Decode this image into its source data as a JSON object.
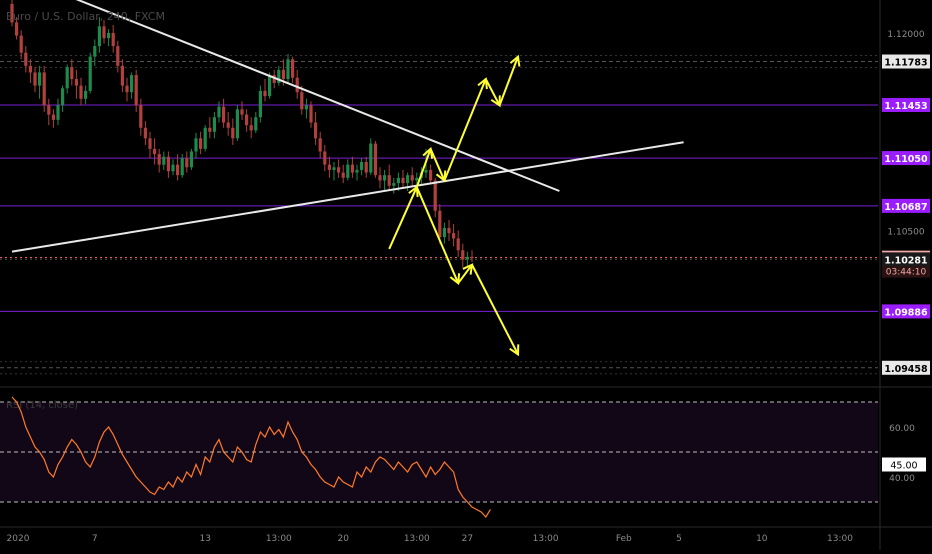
{
  "symbol_title": "Euro / U.S. Dollar, 240, FXCM",
  "colors": {
    "background": "#000000",
    "up_candle": "#1f8a4c",
    "down_candle": "#b2413d",
    "trendline": "#e9e9e9",
    "projection": "#ffff33",
    "level_line": "#7a1fd6",
    "level_badge": "#9b1cff",
    "rsi_line": "#ff7a2a",
    "rsi_fill": "#120716",
    "axis_text": "#8a8a8a"
  },
  "chart_data": [
    {
      "type": "candlestick",
      "title": "Euro / U.S. Dollar, 240, FXCM",
      "x_ticks": [
        "2020",
        "7",
        "13",
        "13:00",
        "20",
        "13:00",
        "27",
        "13:00",
        "Feb",
        "5",
        "10",
        "13:00"
      ],
      "y_ticks": [
        "1.12000",
        "1.10500"
      ],
      "ylim": [
        1.0935,
        1.1225
      ],
      "grid": false,
      "levels": [
        {
          "price": 1.11783,
          "label": "1.11783",
          "style": "gray"
        },
        {
          "price": 1.11453,
          "label": "1.11453",
          "style": "purple"
        },
        {
          "price": 1.1105,
          "label": "1.11050",
          "style": "purple"
        },
        {
          "price": 1.10687,
          "label": "1.10687",
          "style": "purple"
        },
        {
          "price": 1.10294,
          "label": "1.10294",
          "style": "current"
        },
        {
          "price": 1.10281,
          "label": "1.10281",
          "style": "dark"
        },
        {
          "price": 1.09886,
          "label": "1.09886",
          "style": "purple"
        },
        {
          "price": 1.09458,
          "label": "1.09458",
          "style": "gray"
        }
      ],
      "countdown": "03:44:10",
      "ohlc": [
        [
          1.1222,
          1.1225,
          1.1205,
          1.1208
        ],
        [
          1.1208,
          1.1212,
          1.1195,
          1.1198
        ],
        [
          1.1198,
          1.1202,
          1.118,
          1.1185
        ],
        [
          1.1185,
          1.119,
          1.117,
          1.1175
        ],
        [
          1.1175,
          1.118,
          1.1162,
          1.117
        ],
        [
          1.117,
          1.1174,
          1.1155,
          1.116
        ],
        [
          1.116,
          1.1175,
          1.115,
          1.117
        ],
        [
          1.117,
          1.1175,
          1.114,
          1.1145
        ],
        [
          1.1145,
          1.115,
          1.113,
          1.1138
        ],
        [
          1.1138,
          1.1142,
          1.1128,
          1.1134
        ],
        [
          1.1134,
          1.115,
          1.113,
          1.1145
        ],
        [
          1.1145,
          1.116,
          1.114,
          1.1158
        ],
        [
          1.1158,
          1.1176,
          1.1154,
          1.1174
        ],
        [
          1.1174,
          1.118,
          1.116,
          1.1165
        ],
        [
          1.1165,
          1.1172,
          1.115,
          1.116
        ],
        [
          1.116,
          1.1166,
          1.1145,
          1.115
        ],
        [
          1.115,
          1.116,
          1.1146,
          1.1156
        ],
        [
          1.1156,
          1.1185,
          1.1154,
          1.1182
        ],
        [
          1.1182,
          1.1195,
          1.1175,
          1.119
        ],
        [
          1.119,
          1.1212,
          1.1185,
          1.1205
        ],
        [
          1.1205,
          1.121,
          1.1192,
          1.1196
        ],
        [
          1.1196,
          1.1203,
          1.119,
          1.12
        ],
        [
          1.12,
          1.1206,
          1.1185,
          1.119
        ],
        [
          1.119,
          1.1194,
          1.117,
          1.1175
        ],
        [
          1.1175,
          1.118,
          1.1155,
          1.116
        ],
        [
          1.116,
          1.1166,
          1.1148,
          1.1155
        ],
        [
          1.1155,
          1.117,
          1.115,
          1.1168
        ],
        [
          1.1168,
          1.1172,
          1.114,
          1.1145
        ],
        [
          1.1145,
          1.115,
          1.1122,
          1.1128
        ],
        [
          1.1128,
          1.1133,
          1.1115,
          1.112
        ],
        [
          1.112,
          1.1125,
          1.1105,
          1.1112
        ],
        [
          1.1112,
          1.112,
          1.11,
          1.1108
        ],
        [
          1.1108,
          1.1112,
          1.1094,
          1.11
        ],
        [
          1.11,
          1.111,
          1.1096,
          1.1106
        ],
        [
          1.1106,
          1.111,
          1.109,
          1.1095
        ],
        [
          1.1095,
          1.1104,
          1.1092,
          1.11
        ],
        [
          1.11,
          1.1108,
          1.1088,
          1.1092
        ],
        [
          1.1092,
          1.1108,
          1.109,
          1.1105
        ],
        [
          1.1105,
          1.111,
          1.1094,
          1.1098
        ],
        [
          1.1098,
          1.1112,
          1.1096,
          1.111
        ],
        [
          1.111,
          1.1124,
          1.1105,
          1.112
        ],
        [
          1.112,
          1.1125,
          1.1108,
          1.1112
        ],
        [
          1.1112,
          1.113,
          1.111,
          1.1128
        ],
        [
          1.1128,
          1.1136,
          1.112,
          1.1125
        ],
        [
          1.1125,
          1.114,
          1.112,
          1.1136
        ],
        [
          1.1136,
          1.1148,
          1.1132,
          1.1144
        ],
        [
          1.1144,
          1.115,
          1.1128,
          1.1132
        ],
        [
          1.1132,
          1.114,
          1.1122,
          1.1128
        ],
        [
          1.1128,
          1.1135,
          1.1115,
          1.112
        ],
        [
          1.112,
          1.1145,
          1.1118,
          1.1142
        ],
        [
          1.1142,
          1.1148,
          1.1134,
          1.1138
        ],
        [
          1.1138,
          1.1142,
          1.1125,
          1.113
        ],
        [
          1.113,
          1.1136,
          1.112,
          1.1126
        ],
        [
          1.1126,
          1.114,
          1.1124,
          1.1136
        ],
        [
          1.1136,
          1.116,
          1.1132,
          1.1156
        ],
        [
          1.1156,
          1.1165,
          1.1148,
          1.1152
        ],
        [
          1.1152,
          1.117,
          1.115,
          1.1168
        ],
        [
          1.1168,
          1.1172,
          1.1158,
          1.1162
        ],
        [
          1.1162,
          1.1175,
          1.116,
          1.1172
        ],
        [
          1.1172,
          1.118,
          1.116,
          1.1165
        ],
        [
          1.1165,
          1.1184,
          1.1162,
          1.118
        ],
        [
          1.118,
          1.1182,
          1.1162,
          1.1166
        ],
        [
          1.1166,
          1.1172,
          1.115,
          1.1155
        ],
        [
          1.1155,
          1.116,
          1.1138,
          1.1142
        ],
        [
          1.1142,
          1.115,
          1.1135,
          1.1145
        ],
        [
          1.1145,
          1.1148,
          1.1128,
          1.1132
        ],
        [
          1.1132,
          1.114,
          1.1115,
          1.112
        ],
        [
          1.112,
          1.1125,
          1.1105,
          1.111
        ],
        [
          1.111,
          1.1115,
          1.1095,
          1.11
        ],
        [
          1.11,
          1.1106,
          1.109,
          1.1096
        ],
        [
          1.1096,
          1.1102,
          1.1088,
          1.1098
        ],
        [
          1.1098,
          1.1104,
          1.109,
          1.1094
        ],
        [
          1.1094,
          1.11,
          1.1086,
          1.109
        ],
        [
          1.109,
          1.1104,
          1.1088,
          1.11
        ],
        [
          1.11,
          1.1106,
          1.109,
          1.1094
        ],
        [
          1.1094,
          1.11,
          1.1088,
          1.1096
        ],
        [
          1.1096,
          1.1105,
          1.1092,
          1.1102
        ],
        [
          1.1102,
          1.1106,
          1.109,
          1.1094
        ],
        [
          1.1094,
          1.112,
          1.1092,
          1.1116
        ],
        [
          1.1116,
          1.1118,
          1.109,
          1.1092
        ],
        [
          1.1092,
          1.1098,
          1.1082,
          1.1088
        ],
        [
          1.1088,
          1.1096,
          1.108,
          1.1092
        ],
        [
          1.1092,
          1.11,
          1.108,
          1.1084
        ],
        [
          1.1084,
          1.109,
          1.1078,
          1.1086
        ],
        [
          1.1086,
          1.1094,
          1.108,
          1.109
        ],
        [
          1.109,
          1.1096,
          1.1082,
          1.1086
        ],
        [
          1.1086,
          1.1094,
          1.108,
          1.1092
        ],
        [
          1.1092,
          1.1098,
          1.1084,
          1.1088
        ],
        [
          1.1088,
          1.1094,
          1.1082,
          1.109
        ],
        [
          1.109,
          1.1098,
          1.1085,
          1.1094
        ],
        [
          1.1094,
          1.1112,
          1.109,
          1.1096
        ],
        [
          1.1096,
          1.11,
          1.1085,
          1.1088
        ],
        [
          1.1088,
          1.109,
          1.106,
          1.1065
        ],
        [
          1.1065,
          1.107,
          1.104,
          1.1045
        ],
        [
          1.1045,
          1.1056,
          1.104,
          1.1052
        ],
        [
          1.1052,
          1.1058,
          1.1042,
          1.1048
        ],
        [
          1.1048,
          1.1055,
          1.1038,
          1.1044
        ],
        [
          1.1044,
          1.105,
          1.103,
          1.1035
        ],
        [
          1.1035,
          1.104,
          1.1022,
          1.1028
        ],
        [
          1.1028,
          1.1034,
          1.1022,
          1.103
        ],
        [
          1.103,
          1.1035,
          1.1026,
          1.1029
        ]
      ],
      "trendlines": [
        {
          "name": "descending",
          "points": [
            [
              0,
              1.1245
            ],
            [
              119,
              1.108
            ]
          ]
        },
        {
          "name": "ascending",
          "points": [
            [
              0,
              1.1034
            ],
            [
              146,
              1.1117
            ]
          ]
        }
      ],
      "projections": [
        {
          "name": "bullish",
          "points": [
            [
              82,
              1.1036
            ],
            [
              88,
              1.1083
            ],
            [
              91,
              1.1112
            ],
            [
              94,
              1.1088
            ],
            [
              103,
              1.1165
            ],
            [
              106,
              1.1145
            ],
            [
              110,
              1.1182
            ]
          ]
        },
        {
          "name": "bearish",
          "points": [
            [
              88,
              1.1083
            ],
            [
              97,
              1.101
            ],
            [
              100,
              1.1024
            ],
            [
              110,
              1.0956
            ]
          ]
        }
      ]
    },
    {
      "type": "line",
      "title": "RSI (14, close)",
      "y_ticks": [
        60,
        45,
        40
      ],
      "band": [
        30,
        70
      ],
      "ylim": [
        22,
        74
      ],
      "current_label": "45.00",
      "values": [
        72,
        70,
        66,
        60,
        56,
        52,
        50,
        47,
        42,
        40,
        45,
        48,
        52,
        55,
        53,
        50,
        46,
        44,
        48,
        54,
        58,
        60,
        57,
        53,
        49,
        46,
        43,
        40,
        38,
        36,
        34,
        33,
        36,
        35,
        38,
        36,
        40,
        38,
        42,
        40,
        45,
        41,
        48,
        46,
        52,
        55,
        50,
        48,
        46,
        52,
        50,
        47,
        46,
        53,
        58,
        56,
        60,
        57,
        59,
        56,
        62,
        58,
        55,
        50,
        48,
        45,
        43,
        40,
        38,
        37,
        36,
        40,
        38,
        37,
        36,
        42,
        40,
        44,
        42,
        46,
        48,
        47,
        45,
        43,
        46,
        44,
        42,
        45,
        46,
        43,
        40,
        44,
        41,
        43,
        46,
        44,
        42,
        35,
        32,
        30,
        28,
        27,
        26,
        24,
        27
      ]
    }
  ]
}
